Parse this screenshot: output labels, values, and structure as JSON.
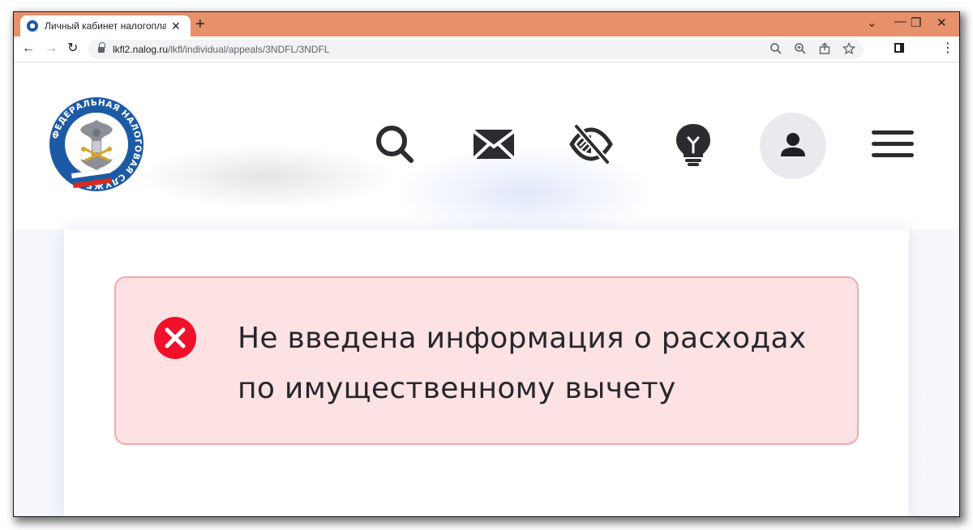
{
  "browser": {
    "tab_title": "Личный кабинет налогоплательщ",
    "tab_close": "✕",
    "new_tab": "+",
    "url_host": "lkfl2.nalog.ru",
    "url_path": "/lkfl/individual/appeals/3NDFL/3NDFL",
    "window_controls": {
      "dropdown": "⌄",
      "minimize": "—",
      "maximize": "❐",
      "close": "✕"
    },
    "nav": {
      "back": "←",
      "forward": "→",
      "reload": "↻"
    },
    "omnibox_icons": [
      "search-icon",
      "zoom-icon",
      "share-icon",
      "bookmark-star-icon"
    ],
    "menu": "⋮",
    "accent_color": "#e8906a"
  },
  "header": {
    "logo": {
      "ring_text": "ФЕДЕРАЛЬНАЯ НАЛОГОВАЯ СЛУЖБА",
      "colors": {
        "ring": "#1d5aa6",
        "flag_white": "#ffffff",
        "flag_blue": "#1d5aa6",
        "flag_red": "#d52b1e"
      }
    },
    "icons": [
      "search-icon",
      "mail-icon",
      "visually-impaired-icon",
      "lightbulb-icon",
      "user-icon",
      "hamburger-menu-icon"
    ],
    "icon_color": "#2b2c30"
  },
  "alert": {
    "message": "Не введена информация о расходах по имущественному вычету",
    "type": "error",
    "colors": {
      "background": "#fde2e4",
      "border": "#f3a7ab",
      "icon": "#f0102a"
    }
  }
}
